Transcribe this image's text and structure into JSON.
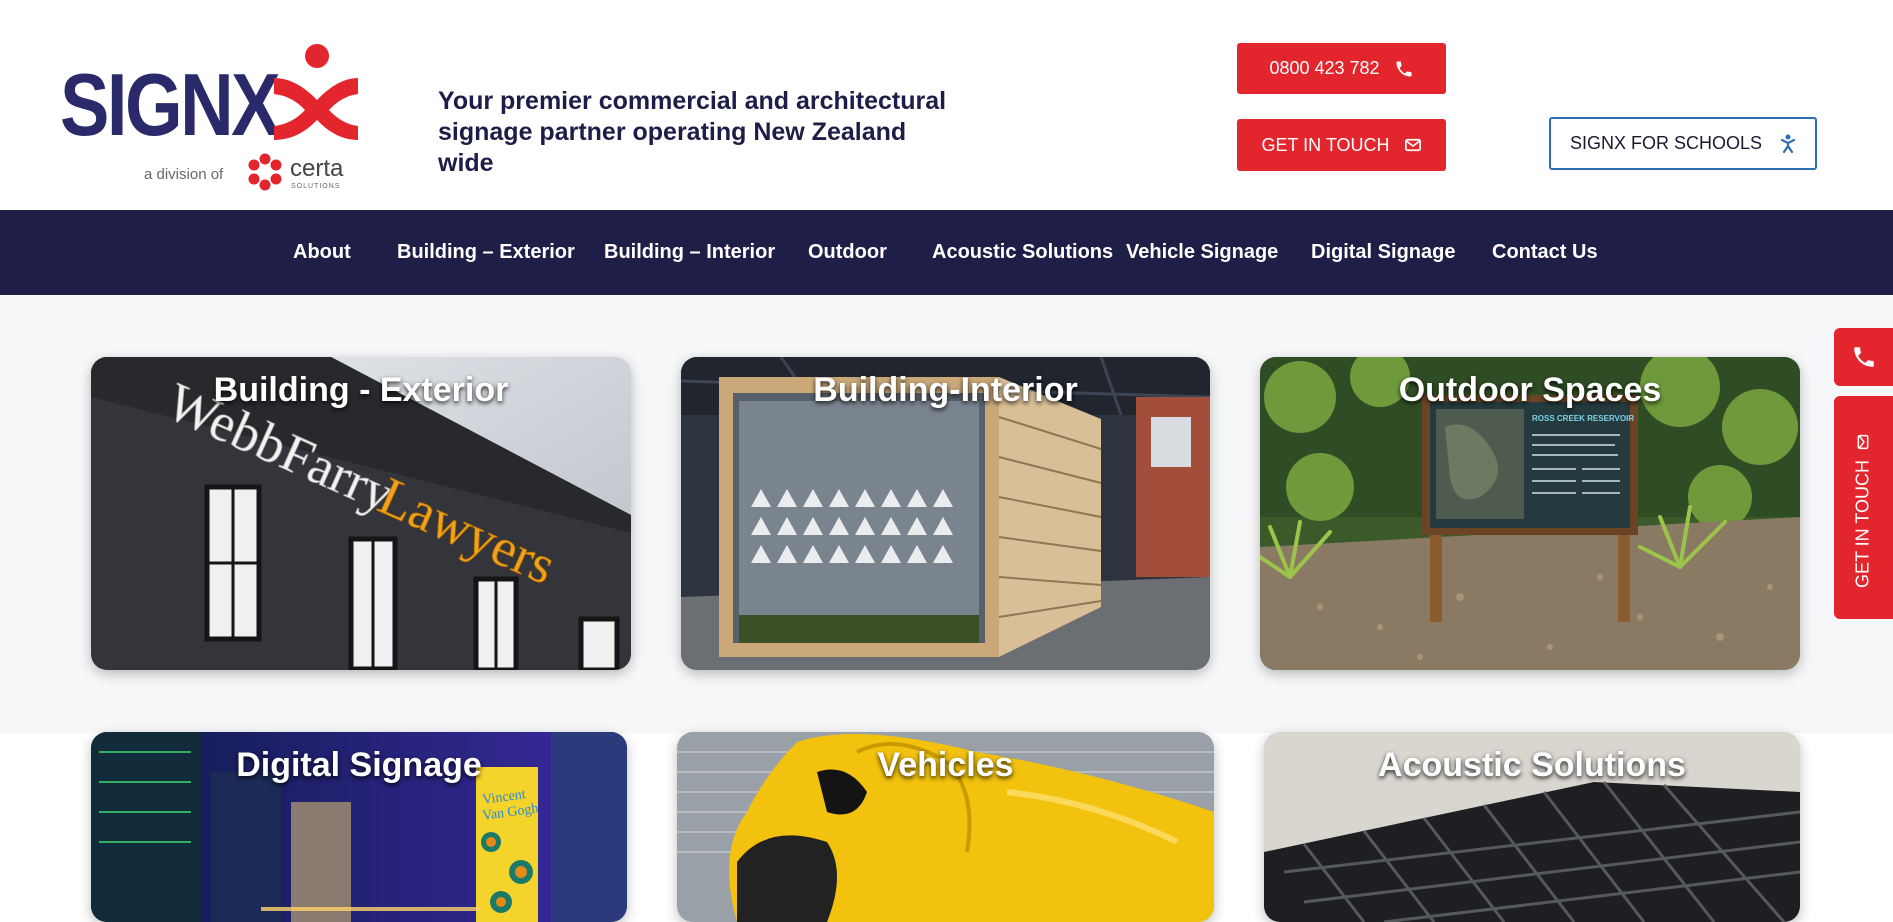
{
  "brand": {
    "logo_text": "SIGNX",
    "division_text": "a division of",
    "partner_name": "certa",
    "partner_sub": "SOLUTIONS",
    "colors": {
      "navy": "#2a2a6b",
      "red": "#e3252d",
      "nav_bg": "#1f1e47"
    }
  },
  "header": {
    "tagline_line1": "Your premier commercial and architectural",
    "tagline_line2": "signage partner operating New Zealand wide",
    "phone_label": "0800 423 782",
    "phone_icon": "phone-icon",
    "contact_label": "GET IN TOUCH",
    "contact_icon": "envelope-icon",
    "schools_label": "SIGNX FOR SCHOOLS",
    "schools_icon": "child-icon"
  },
  "nav": {
    "items": [
      {
        "label": "About"
      },
      {
        "label": "Building – Exterior"
      },
      {
        "label": "Building – Interior"
      },
      {
        "label": "Outdoor"
      },
      {
        "label": "Acoustic Solutions"
      },
      {
        "label": "Vehicle Signage"
      },
      {
        "label": "Digital Signage"
      },
      {
        "label": "Contact Us"
      }
    ]
  },
  "cards": [
    {
      "title": "Building - Exterior",
      "sign_white": "WebbFarry",
      "sign_gold": "Lawyers"
    },
    {
      "title": "Building-Interior"
    },
    {
      "title": "Outdoor Spaces",
      "board_title": "ROSS CREEK RESERVOIR"
    },
    {
      "title": "Digital Signage",
      "billboard_line1": "Vincent",
      "billboard_line2": "Van Gogh"
    },
    {
      "title": "Vehicles"
    },
    {
      "title": "Acoustic Solutions"
    }
  ],
  "sidebar": {
    "phone_icon": "phone-icon",
    "contact_label": "GET IN TOUCH",
    "contact_icon": "envelope-icon"
  }
}
